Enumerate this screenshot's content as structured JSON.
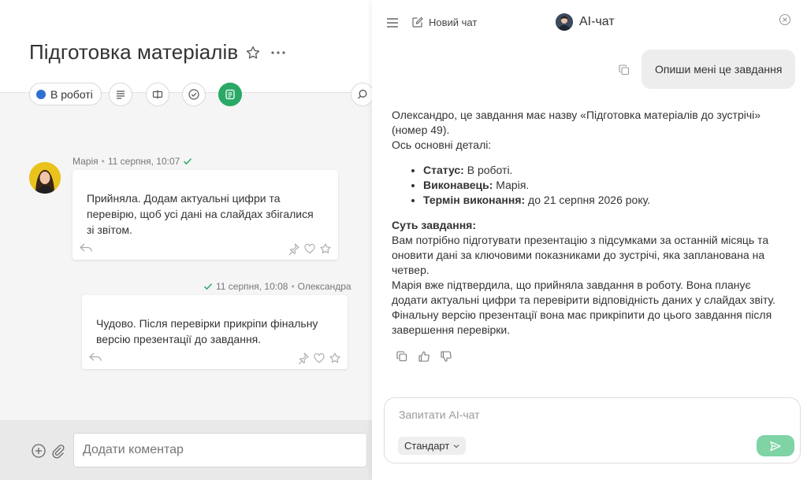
{
  "task": {
    "title": "Підготовка матеріалів",
    "status": "В роботі"
  },
  "messages": [
    {
      "author": "Марія",
      "time": "11 серпня, 10:07",
      "text": "Прийняла. Додам актуальні цифри та перевірю, щоб усі дані на слайдах збігалися зі звітом."
    },
    {
      "author": "Олександра",
      "time": "11 серпня, 10:08",
      "text": "Чудово. Після перевірки прикріпи фінальну версію презентації до завдання."
    }
  ],
  "composer": {
    "placeholder": "Додати коментар"
  },
  "ai_chat": {
    "new_chat_label": "Новий чат",
    "title": "AI-чат",
    "user_message": "Опиши мені це завдання",
    "answer": {
      "intro": "Олександро, це завдання має назву «Підготовка матеріалів до зустрічі» (номер 49).",
      "details_label": "Ось основні деталі:",
      "items": [
        {
          "key": "Статус:",
          "value": " В роботі."
        },
        {
          "key": "Виконавець:",
          "value": " Марія."
        },
        {
          "key": "Термін виконання:",
          "value": " до 21 серпня 2026 року."
        }
      ],
      "essence_title": "Суть завдання:",
      "essence_text": "Вам потрібно підготувати презентацію з підсумками за останній місяць та оновити дані за ключовими показниками до зустрічі, яка запланована на четвер.",
      "progress_text": "Марія вже підтвердила, що прийняла завдання в роботу. Вона планує додати актуальні цифри та перевірити відповідність даних у слайдах звіту. Фінальну версію презентації вона має прикріпити до цього завдання після завершення перевірки."
    },
    "input_placeholder": "Запитати AI-чат",
    "mode": "Стандарт"
  },
  "colors": {
    "accent_green": "#2aa865",
    "status_blue": "#2f6fd1",
    "send_button": "#7fd3a5"
  }
}
